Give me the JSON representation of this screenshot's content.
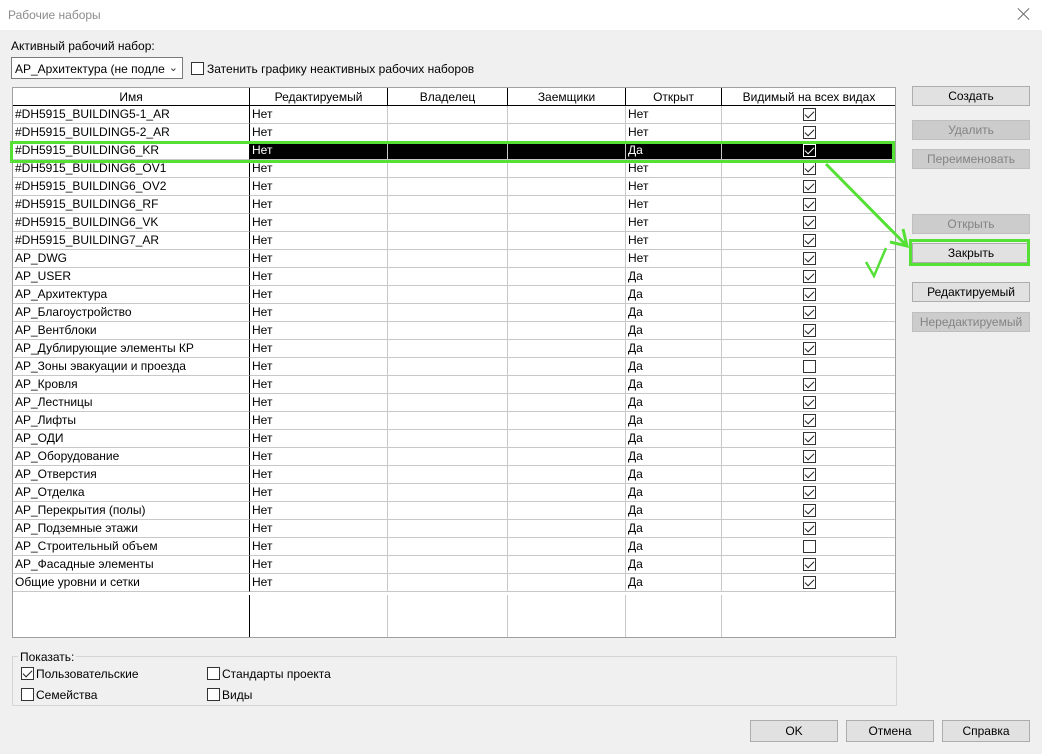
{
  "window": {
    "title": "Рабочие наборы"
  },
  "active": {
    "label": "Активный рабочий набор:",
    "selected": "АР_Архитектура (не подлежит",
    "gray_label": "Затенить графику неактивных рабочих наборов",
    "gray_checked": false
  },
  "table": {
    "headers": [
      "Имя",
      "Редактируемый",
      "Владелец",
      "Заемщики",
      "Открыт",
      "Видимый на всех видах"
    ],
    "rows": [
      {
        "name": "#DH5915_BUILDING5-1_AR",
        "editable": "Нет",
        "open": "Нет",
        "visible": true
      },
      {
        "name": "#DH5915_BUILDING5-2_AR",
        "editable": "Нет",
        "open": "Нет",
        "visible": true
      },
      {
        "name": "#DH5915_BUILDING6_KR",
        "editable": "Нет",
        "open": "Да",
        "visible": true
      },
      {
        "name": "#DH5915_BUILDING6_OV1",
        "editable": "Нет",
        "open": "Нет",
        "visible": true
      },
      {
        "name": "#DH5915_BUILDING6_OV2",
        "editable": "Нет",
        "open": "Нет",
        "visible": true
      },
      {
        "name": "#DH5915_BUILDING6_RF",
        "editable": "Нет",
        "open": "Нет",
        "visible": true
      },
      {
        "name": "#DH5915_BUILDING6_VK",
        "editable": "Нет",
        "open": "Нет",
        "visible": true
      },
      {
        "name": "#DH5915_BUILDING7_AR",
        "editable": "Нет",
        "open": "Нет",
        "visible": true
      },
      {
        "name": "AP_DWG",
        "editable": "Нет",
        "open": "Нет",
        "visible": true
      },
      {
        "name": "AP_USER",
        "editable": "Нет",
        "open": "Да",
        "visible": true
      },
      {
        "name": "АР_Архитектура",
        "editable": "Нет",
        "open": "Да",
        "visible": true
      },
      {
        "name": "АР_Благоустройство",
        "editable": "Нет",
        "open": "Да",
        "visible": true
      },
      {
        "name": "АР_Вентблоки",
        "editable": "Нет",
        "open": "Да",
        "visible": true
      },
      {
        "name": "АР_Дублирующие элементы КР",
        "editable": "Нет",
        "open": "Да",
        "visible": true
      },
      {
        "name": "АР_Зоны эвакуации и проезда",
        "editable": "Нет",
        "open": "Да",
        "visible": false
      },
      {
        "name": "АР_Кровля",
        "editable": "Нет",
        "open": "Да",
        "visible": true
      },
      {
        "name": "АР_Лестницы",
        "editable": "Нет",
        "open": "Да",
        "visible": true
      },
      {
        "name": "АР_Лифты",
        "editable": "Нет",
        "open": "Да",
        "visible": true
      },
      {
        "name": "АР_ОДИ",
        "editable": "Нет",
        "open": "Да",
        "visible": true
      },
      {
        "name": "АР_Оборудование",
        "editable": "Нет",
        "open": "Да",
        "visible": true
      },
      {
        "name": "АР_Отверстия",
        "editable": "Нет",
        "open": "Да",
        "visible": true
      },
      {
        "name": "АР_Отделка",
        "editable": "Нет",
        "open": "Да",
        "visible": true
      },
      {
        "name": "АР_Перекрытия (полы)",
        "editable": "Нет",
        "open": "Да",
        "visible": true
      },
      {
        "name": "АР_Подземные этажи",
        "editable": "Нет",
        "open": "Да",
        "visible": true
      },
      {
        "name": "АР_Строительный объем",
        "editable": "Нет",
        "open": "Да",
        "visible": false
      },
      {
        "name": "АР_Фасадные элементы",
        "editable": "Нет",
        "open": "Да",
        "visible": true
      },
      {
        "name": "Общие уровни и сетки",
        "editable": "Нет",
        "open": "Да",
        "visible": true
      }
    ],
    "selected_index": 2
  },
  "buttons": {
    "create": "Создать",
    "delete": "Удалить",
    "rename": "Переименовать",
    "open": "Открыть",
    "close": "Закрыть",
    "editable": "Редактируемый",
    "non_editable": "Нередактируемый"
  },
  "show": {
    "label": "Показать:",
    "user": "Пользовательские",
    "user_checked": true,
    "families": "Семейства",
    "families_checked": false,
    "standards": "Стандарты проекта",
    "standards_checked": false,
    "views": "Виды",
    "views_checked": false
  },
  "footer": {
    "ok": "OK",
    "cancel": "Отмена",
    "help": "Справка"
  },
  "annotation_color": "#55e035"
}
